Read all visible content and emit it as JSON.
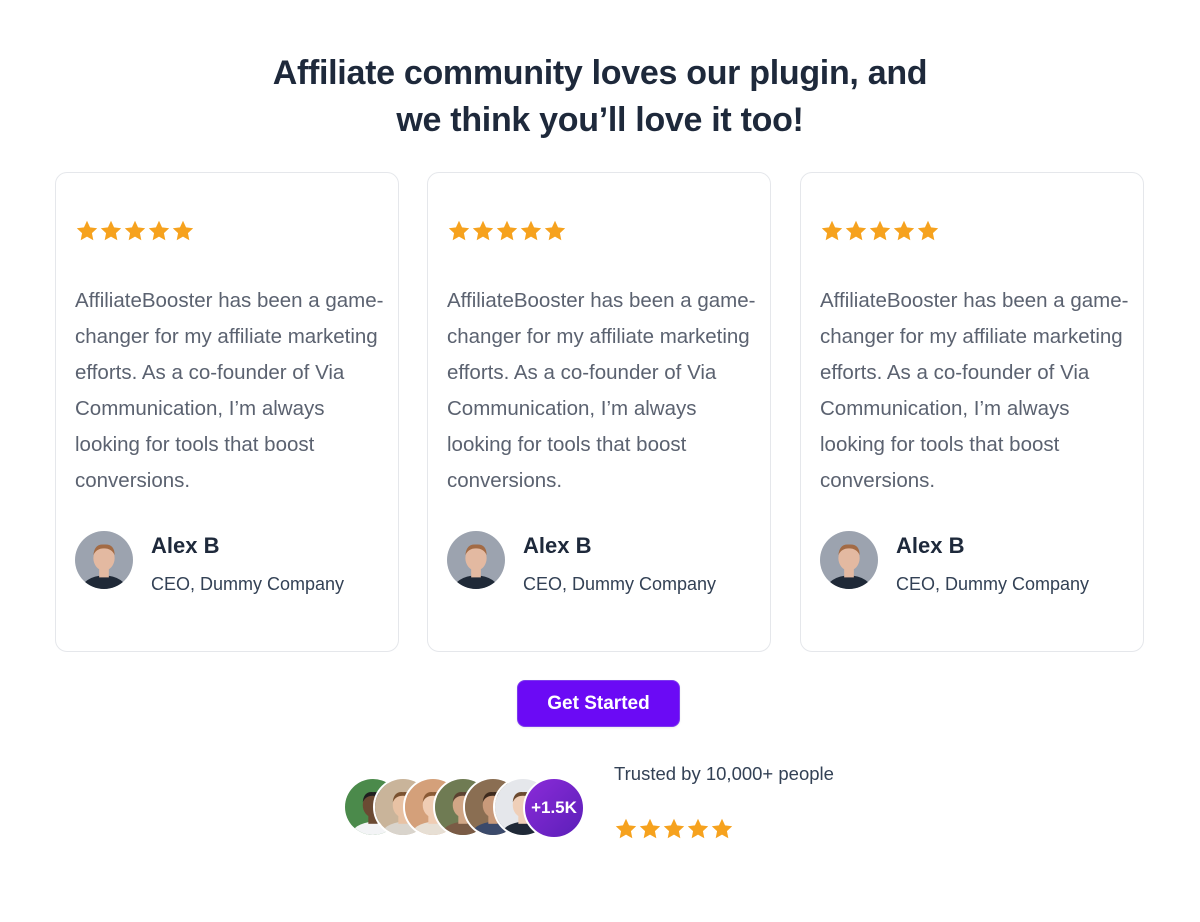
{
  "heading": {
    "line1": "Affiliate community loves our plugin, and",
    "line2": "we think you’ll love it too!"
  },
  "colors": {
    "star": "#f6a21e",
    "cta": "#6b0af5",
    "heading": "#1e293b",
    "body_text": "#5b6270"
  },
  "testimonials": [
    {
      "rating": 5,
      "quote": "AffiliateBooster has been a game-changer for my affiliate marketing efforts. As a co-founder of Via Communication, I’m always looking for tools that boost conversions.",
      "name": "Alex B",
      "role": "CEO, Dummy Company"
    },
    {
      "rating": 5,
      "quote": "AffiliateBooster has been a game-changer for my affiliate marketing efforts. As a co-founder of Via Communication, I’m always looking for tools that boost conversions.",
      "name": "Alex B",
      "role": "CEO, Dummy Company"
    },
    {
      "rating": 5,
      "quote": "AffiliateBooster has been a game-changer for my affiliate marketing efforts. As a co-founder of Via Communication, I’m always looking for tools that boost conversions.",
      "name": "Alex B",
      "role": "CEO, Dummy Company"
    }
  ],
  "cta": {
    "label": "Get Started"
  },
  "trust": {
    "text": "Trusted by 10,000+ people",
    "more_badge": "+1.5K",
    "rating": 5
  },
  "icons": {
    "star": "star-icon",
    "avatar": "avatar-photo"
  }
}
